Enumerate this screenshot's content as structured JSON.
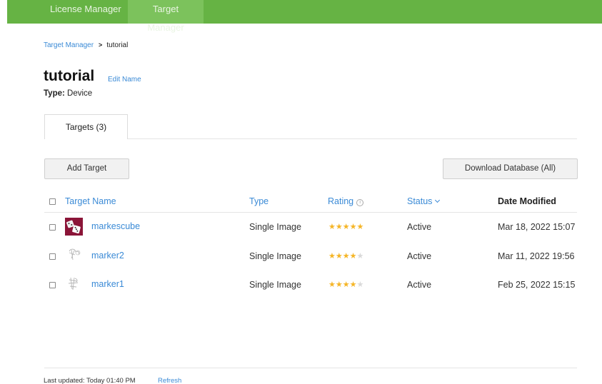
{
  "topnav": {
    "license_manager": "License Manager",
    "target_manager": "Target Manager"
  },
  "breadcrumb": {
    "root": "Target Manager",
    "current": "tutorial"
  },
  "database": {
    "name": "tutorial",
    "edit_label": "Edit Name",
    "type_key": "Type:",
    "type_value": "Device"
  },
  "tabs": {
    "targets": "Targets (3)"
  },
  "actions": {
    "add_target": "Add Target",
    "download_database": "Download Database (All)"
  },
  "table": {
    "headers": {
      "target_name": "Target Name",
      "type": "Type",
      "rating": "Rating",
      "status": "Status",
      "date_modified": "Date Modified"
    },
    "rows": [
      {
        "name": "markescube",
        "type": "Single Image",
        "rating": 5,
        "status": "Active",
        "date_modified": "Mar 18, 2022 15:07",
        "thumb": "dice-thumbnail-icon"
      },
      {
        "name": "marker2",
        "type": "Single Image",
        "rating": 4,
        "status": "Active",
        "date_modified": "Mar 11, 2022 19:56",
        "thumb": "sketch-thumbnail-icon"
      },
      {
        "name": "marker1",
        "type": "Single Image",
        "rating": 4,
        "status": "Active",
        "date_modified": "Feb 25, 2022 15:15",
        "thumb": "sketch-thumbnail-icon"
      }
    ]
  },
  "footer": {
    "last_updated": "Last updated: Today 01:40 PM",
    "refresh": "Refresh"
  },
  "colors": {
    "brand_green": "#66b344",
    "active_tab_green": "#7cc25c",
    "link_blue": "#3a8ad6",
    "star_gold": "#f5b526",
    "thumb_maroon": "#8b1538"
  },
  "icons": {
    "info": "info-icon",
    "sort": "chevron-down-icon",
    "star": "star-icon",
    "checkbox": "checkbox-icon"
  }
}
